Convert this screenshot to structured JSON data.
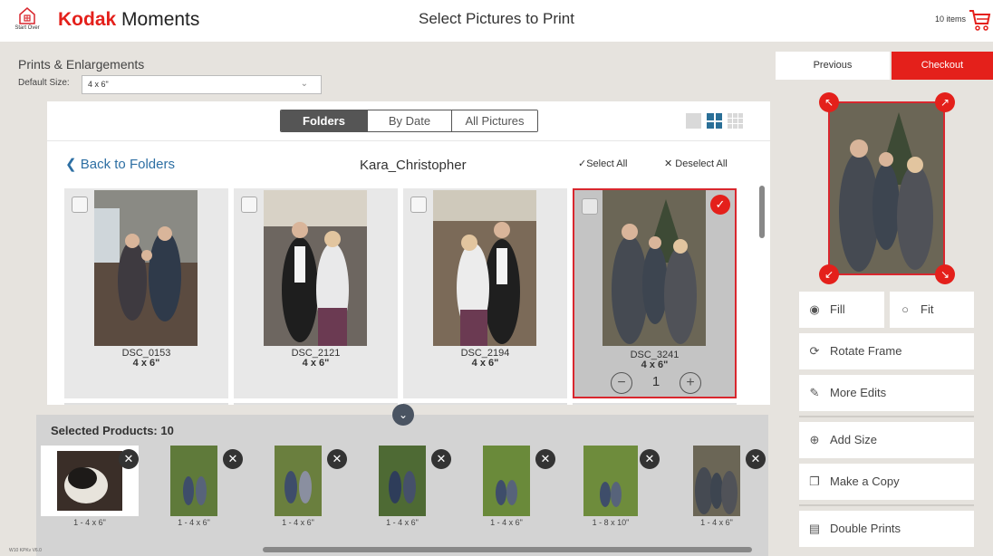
{
  "header": {
    "home_label": "Start Over",
    "brand_word": "Kodak",
    "brand_rest": " Moments",
    "title": "Select Pictures to Print",
    "cart_count": "10 items"
  },
  "settings": {
    "section_title": "Prints & Enlargements",
    "default_size_label": "Default Size:",
    "default_size_value": "4 x 6\""
  },
  "tabs": [
    {
      "label": "Folders",
      "active": true
    },
    {
      "label": "By Date",
      "active": false
    },
    {
      "label": "All Pictures",
      "active": false
    }
  ],
  "browser": {
    "back_label": "Back to Folders",
    "folder_name": "Kara_Christopher",
    "select_all": "Select All",
    "deselect_all": "Deselect All"
  },
  "photos": [
    {
      "name": "DSC_0153",
      "size": "4 x 6\"",
      "selected": false
    },
    {
      "name": "DSC_2121",
      "size": "4 x 6\"",
      "selected": false
    },
    {
      "name": "DSC_2194",
      "size": "4 x 6\"",
      "selected": false
    },
    {
      "name": "DSC_3241",
      "size": "4 x 6\"",
      "selected": true,
      "quantity": "1"
    }
  ],
  "selected_products": {
    "title": "Selected Products: 10",
    "items": [
      {
        "label": "1 - 4 x 6\""
      },
      {
        "label": "1 - 4 x 6\""
      },
      {
        "label": "1 - 4 x 6\""
      },
      {
        "label": "1 - 4 x 6\""
      },
      {
        "label": "1 - 4 x 6\""
      },
      {
        "label": "1 - 8 x 10\""
      },
      {
        "label": "1 - 4 x 6\""
      }
    ]
  },
  "nav": {
    "previous": "Previous",
    "checkout": "Checkout"
  },
  "options": {
    "fill": "Fill",
    "fit": "Fit",
    "rotate": "Rotate Frame",
    "more_edits": "More Edits",
    "add_size": "Add Size",
    "make_copy": "Make a Copy",
    "double_prints": "Double Prints"
  },
  "version": "W10 KPKv V6.0",
  "colors": {
    "accent": "#e4201b",
    "link": "#2d6fa3",
    "tab_active": "#555555"
  }
}
